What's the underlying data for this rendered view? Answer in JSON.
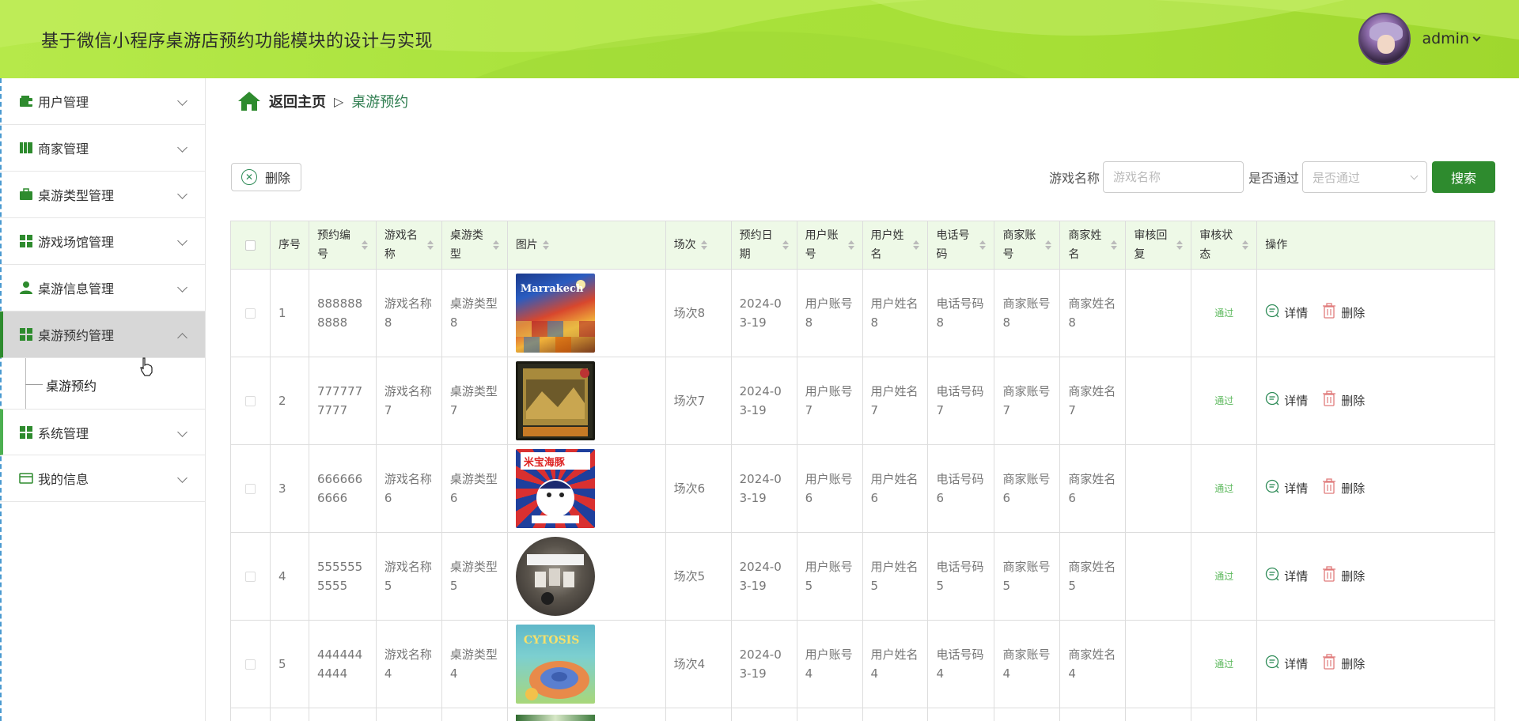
{
  "header": {
    "title": "基于微信小程序桌游店预约功能模块的设计与实现",
    "username": "admin"
  },
  "sidebar": {
    "items": [
      {
        "label": "用户管理",
        "icon": "wallet-icon"
      },
      {
        "label": "商家管理",
        "icon": "book-icon"
      },
      {
        "label": "桌游类型管理",
        "icon": "briefcase-icon"
      },
      {
        "label": "游戏场馆管理",
        "icon": "grid-icon"
      },
      {
        "label": "桌游信息管理",
        "icon": "user-icon"
      },
      {
        "label": "桌游预约管理",
        "icon": "grid-icon"
      },
      {
        "label": "系统管理",
        "icon": "grid-icon"
      },
      {
        "label": "我的信息",
        "icon": "card-icon"
      }
    ],
    "submenu_label": "桌游预约"
  },
  "breadcrumb": {
    "home": "返回主页",
    "separator": "▷",
    "current": "桌游预约"
  },
  "toolbar": {
    "delete_label": "删除",
    "game_name_label": "游戏名称",
    "game_name_placeholder": "游戏名称",
    "approved_label": "是否通过",
    "approved_placeholder": "是否通过",
    "search_label": "搜索"
  },
  "table": {
    "headers": [
      "序号",
      "预约编号",
      "游戏名称",
      "桌游类型",
      "图片",
      "场次",
      "预约日期",
      "用户账号",
      "用户姓名",
      "电话号码",
      "商家账号",
      "商家姓名",
      "审核回复",
      "审核状态",
      "操作"
    ],
    "detail_label": "详情",
    "delete_label": "删除",
    "rows": [
      {
        "idx": "1",
        "no": "8888888888",
        "name": "游戏名称8",
        "type": "桌游类型8",
        "image": "Marrakech",
        "session": "场次8",
        "date": "2024-03-19",
        "account": "用户账号8",
        "uname": "用户姓名8",
        "phone": "电话号码8",
        "maccount": "商家账号8",
        "mname": "商家姓名8",
        "reply": "",
        "status": "通过"
      },
      {
        "idx": "2",
        "no": "7777777777",
        "name": "游戏名称7",
        "type": "桌游类型7",
        "image": "",
        "session": "场次7",
        "date": "2024-03-19",
        "account": "用户账号7",
        "uname": "用户姓名7",
        "phone": "电话号码7",
        "maccount": "商家账号7",
        "mname": "商家姓名7",
        "reply": "",
        "status": "通过"
      },
      {
        "idx": "3",
        "no": "6666666666",
        "name": "游戏名称6",
        "type": "桌游类型6",
        "image": "米宝海豚",
        "session": "场次6",
        "date": "2024-03-19",
        "account": "用户账号6",
        "uname": "用户姓名6",
        "phone": "电话号码6",
        "maccount": "商家账号6",
        "mname": "商家姓名6",
        "reply": "",
        "status": "通过"
      },
      {
        "idx": "4",
        "no": "5555555555",
        "name": "游戏名称5",
        "type": "桌游类型5",
        "image": "",
        "session": "场次5",
        "date": "2024-03-19",
        "account": "用户账号5",
        "uname": "用户姓名5",
        "phone": "电话号码5",
        "maccount": "商家账号5",
        "mname": "商家姓名5",
        "reply": "",
        "status": "通过"
      },
      {
        "idx": "5",
        "no": "4444444444",
        "name": "游戏名称4",
        "type": "桌游类型4",
        "image": "CYTOSIS",
        "session": "场次4",
        "date": "2024-03-19",
        "account": "用户账号4",
        "uname": "用户姓名4",
        "phone": "电话号码4",
        "maccount": "商家账号4",
        "mname": "商家姓名4",
        "reply": "",
        "status": "通过"
      }
    ]
  },
  "colors": {
    "accent": "#2e8b2e",
    "header_bg": "#a9e23c",
    "table_header_bg": "#eef9e7",
    "status_green": "#5cb85c"
  }
}
